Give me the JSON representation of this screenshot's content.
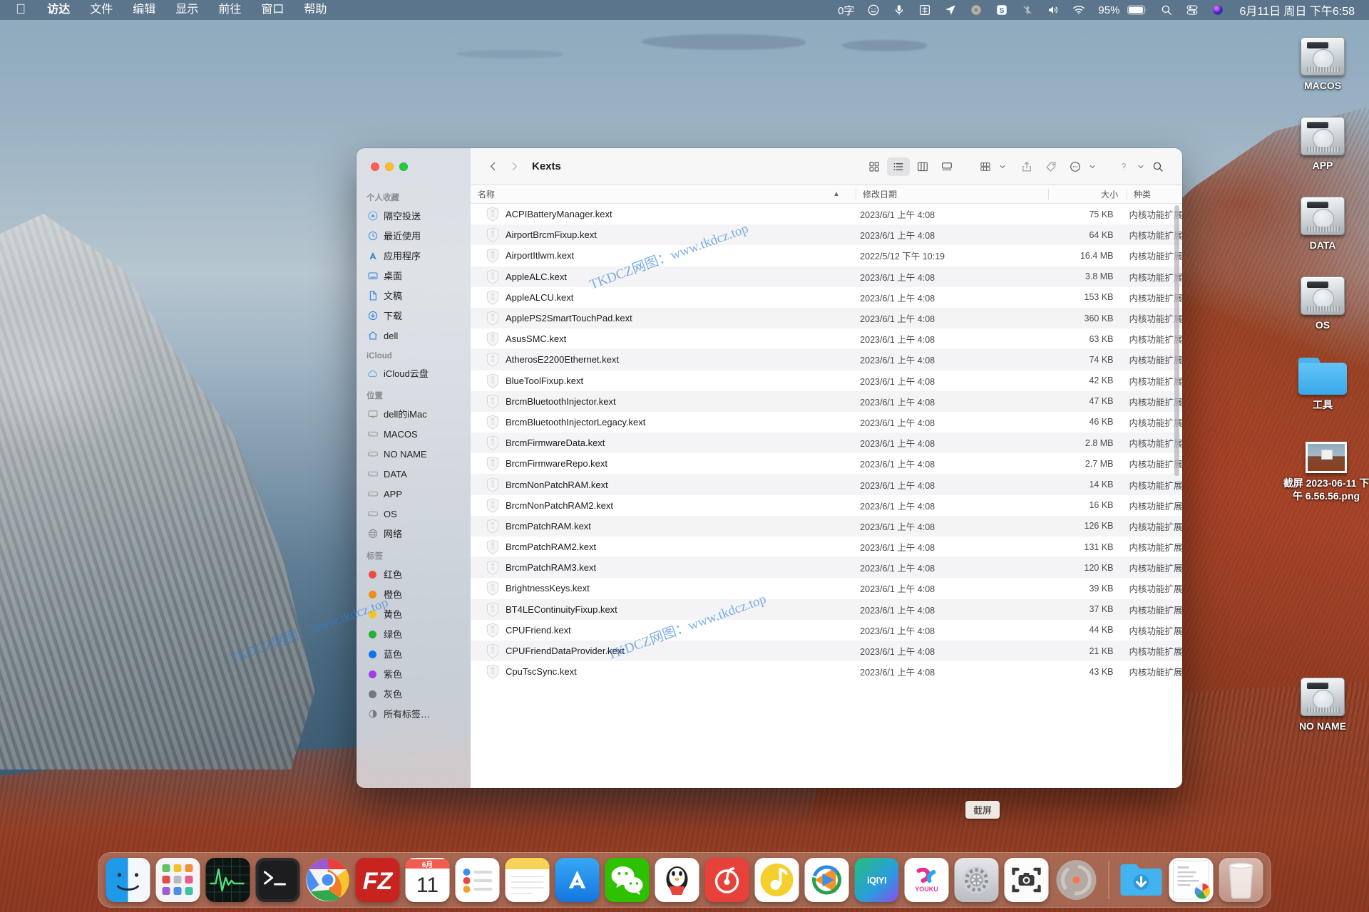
{
  "menubar": {
    "apple_icon": "apple-logo-icon",
    "items": [
      "访达",
      "文件",
      "编辑",
      "显示",
      "前往",
      "窗口",
      "帮助"
    ],
    "status": {
      "word_count": "0字",
      "icons": [
        "smiley-icon",
        "microphone-icon",
        "input-source-chinese-icon",
        "location-arrow-icon",
        "siri-icon",
        "sogou-input-icon",
        "bluetooth-off-icon",
        "volume-icon",
        "wifi-icon"
      ],
      "battery_percent": "95%",
      "right_icons": [
        "search-icon",
        "control-center-icon",
        "siri-orb-icon"
      ],
      "clock": "6月11日 周日 下午6:58"
    }
  },
  "desktop_icons": [
    {
      "label": "MACOS",
      "type": "hard-drive"
    },
    {
      "label": "APP",
      "type": "hard-drive"
    },
    {
      "label": "DATA",
      "type": "hard-drive"
    },
    {
      "label": "OS",
      "type": "hard-drive"
    },
    {
      "label": "工具",
      "type": "folder"
    },
    {
      "label": "截屏 2023-06-11 下午 6.56.56.png",
      "type": "image-thumbnail"
    },
    {
      "label": "NO NAME",
      "type": "hard-drive"
    }
  ],
  "finder": {
    "title": "Kexts",
    "traffic_lights": [
      "close-button",
      "minimize-button",
      "zoom-button"
    ],
    "nav": {
      "back": "chevron-left-icon",
      "forward": "chevron-right-icon"
    },
    "toolbar_buttons": [
      {
        "name": "icon-view-button",
        "icon": "grid-icon",
        "active": false
      },
      {
        "name": "list-view-button",
        "icon": "list-icon",
        "active": true
      },
      {
        "name": "column-view-button",
        "icon": "columns-icon",
        "active": false
      },
      {
        "name": "gallery-view-button",
        "icon": "gallery-icon",
        "active": false
      },
      {
        "name": "group-by-button",
        "icon": "group-icon",
        "active": false
      },
      {
        "name": "share-button",
        "icon": "share-icon",
        "active": false
      },
      {
        "name": "tags-button",
        "icon": "tag-icon",
        "active": false
      },
      {
        "name": "more-actions-button",
        "icon": "ellipsis-circle-icon",
        "active": false
      },
      {
        "name": "help-button",
        "icon": "question-mark-icon",
        "active": false
      },
      {
        "name": "search-button",
        "icon": "magnifier-icon",
        "active": false
      }
    ],
    "sidebar": {
      "sections": [
        {
          "title": "个人收藏",
          "items": [
            {
              "label": "隔空投送",
              "icon": "airdrop-icon"
            },
            {
              "label": "最近使用",
              "icon": "clock-icon"
            },
            {
              "label": "应用程序",
              "icon": "applications-icon"
            },
            {
              "label": "桌面",
              "icon": "desktop-icon"
            },
            {
              "label": "文稿",
              "icon": "document-icon"
            },
            {
              "label": "下载",
              "icon": "download-icon"
            },
            {
              "label": "dell",
              "icon": "home-icon"
            }
          ]
        },
        {
          "title": "iCloud",
          "items": [
            {
              "label": "iCloud云盘",
              "icon": "cloud-icon"
            }
          ]
        },
        {
          "title": "位置",
          "items": [
            {
              "label": "dell的iMac",
              "icon": "computer-icon"
            },
            {
              "label": "MACOS",
              "icon": "disk-icon"
            },
            {
              "label": "NO NAME",
              "icon": "disk-icon"
            },
            {
              "label": "DATA",
              "icon": "disk-icon"
            },
            {
              "label": "APP",
              "icon": "disk-icon"
            },
            {
              "label": "OS",
              "icon": "disk-icon"
            },
            {
              "label": "网络",
              "icon": "globe-icon"
            }
          ]
        },
        {
          "title": "标签",
          "items": [
            {
              "label": "红色",
              "icon": "tag-dot",
              "color": "#f24b42"
            },
            {
              "label": "橙色",
              "icon": "tag-dot",
              "color": "#ef8c1b"
            },
            {
              "label": "黄色",
              "icon": "tag-dot",
              "color": "#f5c518"
            },
            {
              "label": "绿色",
              "icon": "tag-dot",
              "color": "#25b03a"
            },
            {
              "label": "蓝色",
              "icon": "tag-dot",
              "color": "#1273f0"
            },
            {
              "label": "紫色",
              "icon": "tag-dot",
              "color": "#a53ce0"
            },
            {
              "label": "灰色",
              "icon": "tag-dot",
              "color": "#77787c"
            },
            {
              "label": "所有标签…",
              "icon": "all-tags-icon",
              "color": "#77787c"
            }
          ]
        }
      ]
    },
    "columns": [
      "名称",
      "修改日期",
      "大小",
      "种类"
    ],
    "sort_indicator": "ascending-caret",
    "files": [
      {
        "name": "ACPIBatteryManager.kext",
        "date": "2023/6/1 上午 4:08",
        "size": "75 KB",
        "kind": "内核功能扩展"
      },
      {
        "name": "AirportBrcmFixup.kext",
        "date": "2023/6/1 上午 4:08",
        "size": "64 KB",
        "kind": "内核功能扩展"
      },
      {
        "name": "AirportItlwm.kext",
        "date": "2022/5/12 下午 10:19",
        "size": "16.4 MB",
        "kind": "内核功能扩展"
      },
      {
        "name": "AppleALC.kext",
        "date": "2023/6/1 上午 4:08",
        "size": "3.8 MB",
        "kind": "内核功能扩展"
      },
      {
        "name": "AppleALCU.kext",
        "date": "2023/6/1 上午 4:08",
        "size": "153 KB",
        "kind": "内核功能扩展"
      },
      {
        "name": "ApplePS2SmartTouchPad.kext",
        "date": "2023/6/1 上午 4:08",
        "size": "360 KB",
        "kind": "内核功能扩展"
      },
      {
        "name": "AsusSMC.kext",
        "date": "2023/6/1 上午 4:08",
        "size": "63 KB",
        "kind": "内核功能扩展"
      },
      {
        "name": "AtherosE2200Ethernet.kext",
        "date": "2023/6/1 上午 4:08",
        "size": "74 KB",
        "kind": "内核功能扩展"
      },
      {
        "name": "BlueToolFixup.kext",
        "date": "2023/6/1 上午 4:08",
        "size": "42 KB",
        "kind": "内核功能扩展"
      },
      {
        "name": "BrcmBluetoothInjector.kext",
        "date": "2023/6/1 上午 4:08",
        "size": "47 KB",
        "kind": "内核功能扩展"
      },
      {
        "name": "BrcmBluetoothInjectorLegacy.kext",
        "date": "2023/6/1 上午 4:08",
        "size": "46 KB",
        "kind": "内核功能扩展"
      },
      {
        "name": "BrcmFirmwareData.kext",
        "date": "2023/6/1 上午 4:08",
        "size": "2.8 MB",
        "kind": "内核功能扩展"
      },
      {
        "name": "BrcmFirmwareRepo.kext",
        "date": "2023/6/1 上午 4:08",
        "size": "2.7 MB",
        "kind": "内核功能扩展"
      },
      {
        "name": "BrcmNonPatchRAM.kext",
        "date": "2023/6/1 上午 4:08",
        "size": "14 KB",
        "kind": "内核功能扩展"
      },
      {
        "name": "BrcmNonPatchRAM2.kext",
        "date": "2023/6/1 上午 4:08",
        "size": "16 KB",
        "kind": "内核功能扩展"
      },
      {
        "name": "BrcmPatchRAM.kext",
        "date": "2023/6/1 上午 4:08",
        "size": "126 KB",
        "kind": "内核功能扩展"
      },
      {
        "name": "BrcmPatchRAM2.kext",
        "date": "2023/6/1 上午 4:08",
        "size": "131 KB",
        "kind": "内核功能扩展"
      },
      {
        "name": "BrcmPatchRAM3.kext",
        "date": "2023/6/1 上午 4:08",
        "size": "120 KB",
        "kind": "内核功能扩展"
      },
      {
        "name": "BrightnessKeys.kext",
        "date": "2023/6/1 上午 4:08",
        "size": "39 KB",
        "kind": "内核功能扩展"
      },
      {
        "name": "BT4LEContinuityFixup.kext",
        "date": "2023/6/1 上午 4:08",
        "size": "37 KB",
        "kind": "内核功能扩展"
      },
      {
        "name": "CPUFriend.kext",
        "date": "2023/6/1 上午 4:08",
        "size": "44 KB",
        "kind": "内核功能扩展"
      },
      {
        "name": "CPUFriendDataProvider.kext",
        "date": "2023/6/1 上午 4:08",
        "size": "21 KB",
        "kind": "内核功能扩展"
      },
      {
        "name": "CpuTscSync.kext",
        "date": "2023/6/1 上午 4:08",
        "size": "43 KB",
        "kind": "内核功能扩展"
      }
    ]
  },
  "watermarks": [
    "TKDCZ网图：www.tkdcz.top",
    "TKDCZ网图：www.tkdcz.top",
    "TKDCZ网图：www.tkdcz.top"
  ],
  "tooltip": "截屏",
  "dock": {
    "apps": [
      {
        "name": "finder",
        "label": "",
        "icon": "finder-icon",
        "running": true
      },
      {
        "name": "launchpad",
        "label": "",
        "icon": "launchpad-icon",
        "running": false
      },
      {
        "name": "activity-monitor",
        "label": "",
        "icon": "activity-monitor-icon",
        "running": false
      },
      {
        "name": "terminal",
        "label": "",
        "icon": "terminal-icon",
        "running": true
      },
      {
        "name": "chrome",
        "label": "",
        "icon": "chrome-icon",
        "running": false
      },
      {
        "name": "filezilla",
        "label": "FZ",
        "icon": "filezilla-icon",
        "running": false
      },
      {
        "name": "calendar",
        "label": "11",
        "sublabel": "6月",
        "icon": "calendar-icon",
        "running": false
      },
      {
        "name": "reminders",
        "label": "",
        "icon": "reminders-icon",
        "running": false
      },
      {
        "name": "notes",
        "label": "",
        "icon": "notes-icon",
        "running": false
      },
      {
        "name": "app-store",
        "label": "",
        "icon": "app-store-icon",
        "running": false
      },
      {
        "name": "wechat",
        "label": "",
        "icon": "wechat-icon",
        "running": false
      },
      {
        "name": "qq",
        "label": "",
        "icon": "qq-icon",
        "running": false
      },
      {
        "name": "netease-music",
        "label": "",
        "icon": "netease-music-icon",
        "running": false
      },
      {
        "name": "qq-music",
        "label": "",
        "icon": "qq-music-icon",
        "running": false
      },
      {
        "name": "tencent-video",
        "label": "",
        "icon": "tencent-video-icon",
        "running": false
      },
      {
        "name": "iqiyi",
        "label": "iQIYI",
        "icon": "iqiyi-icon",
        "running": false
      },
      {
        "name": "youku",
        "label": "YOUKU",
        "icon": "youku-icon",
        "running": false
      },
      {
        "name": "system-preferences",
        "label": "",
        "icon": "gear-icon",
        "running": false
      },
      {
        "name": "screenshot",
        "label": "",
        "icon": "camera-icon",
        "running": true
      },
      {
        "name": "unknown-disc",
        "label": "",
        "icon": "disc-icon",
        "running": false
      }
    ],
    "right_items": [
      {
        "name": "downloads-stack",
        "icon": "downloads-folder-icon"
      },
      {
        "name": "recent-file",
        "icon": "document-preview-icon"
      },
      {
        "name": "trash",
        "icon": "trash-icon"
      }
    ]
  }
}
